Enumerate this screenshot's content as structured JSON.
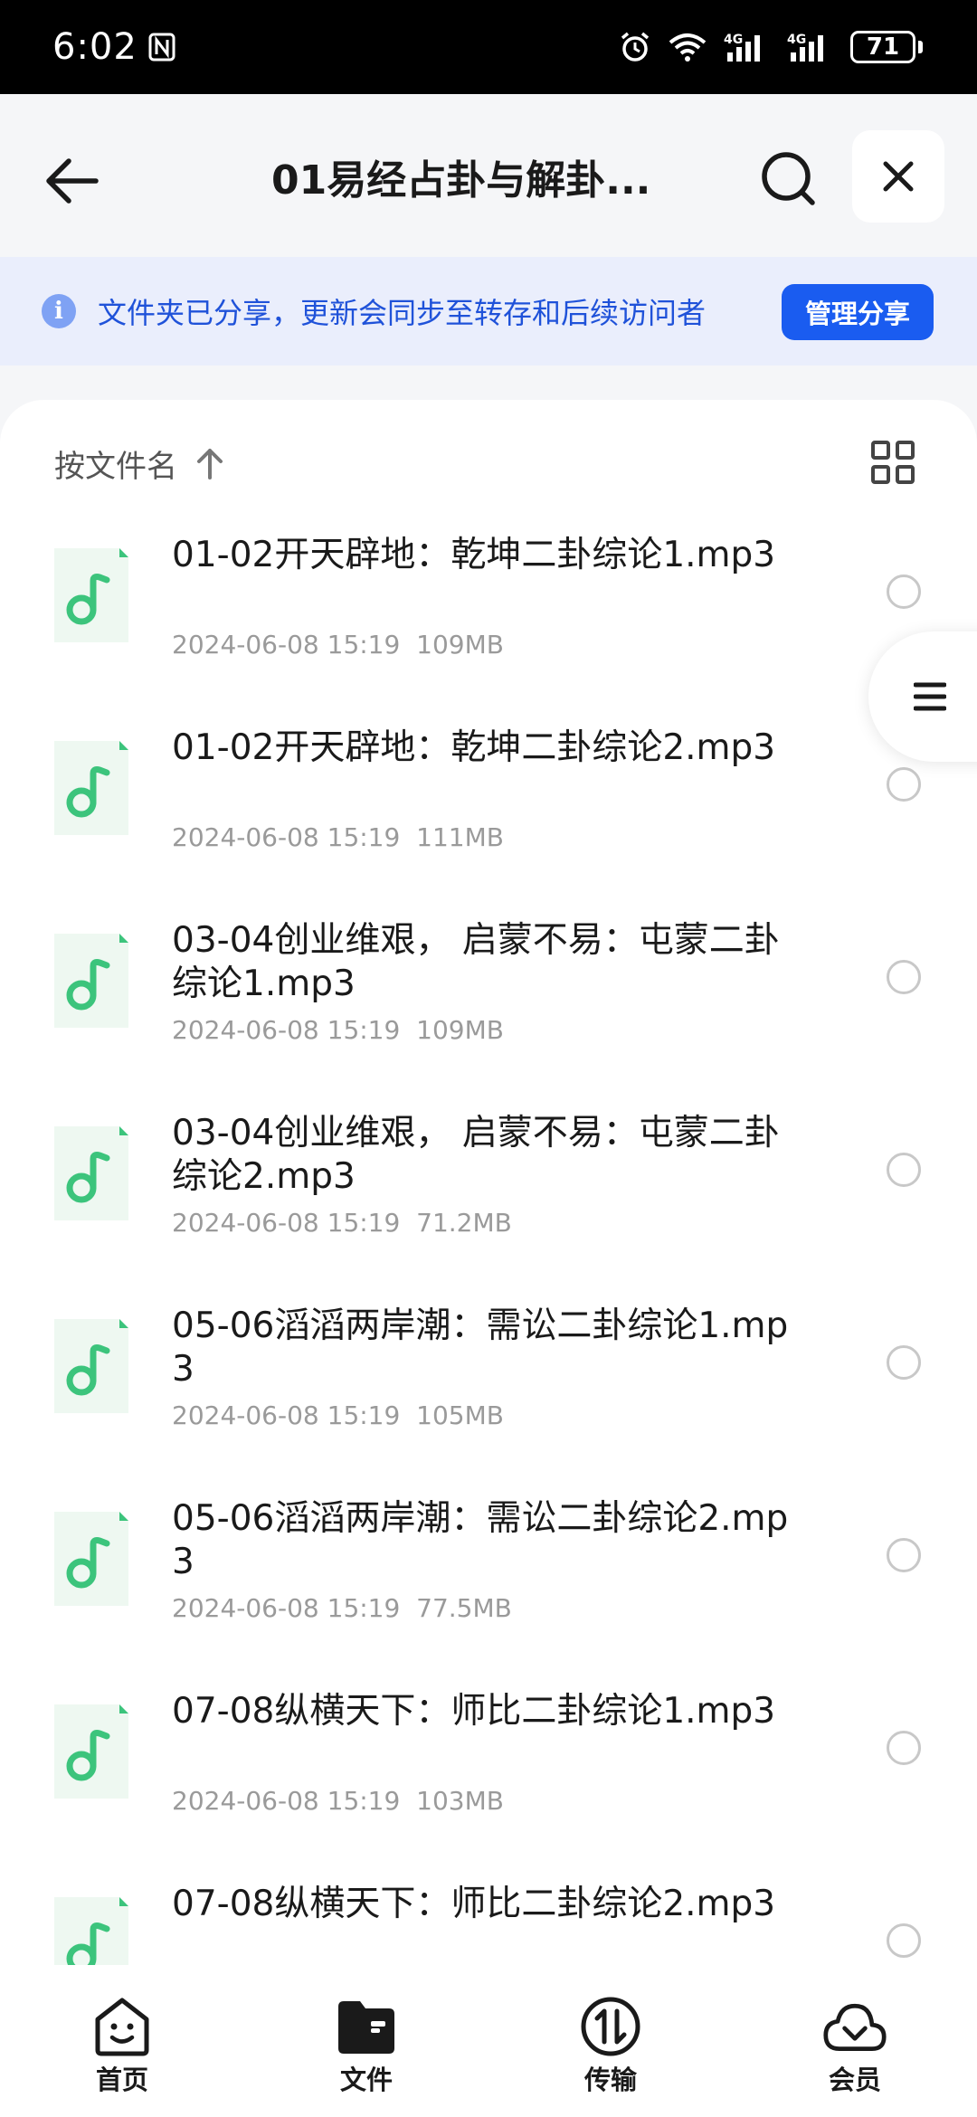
{
  "status_bar": {
    "time": "6:02",
    "battery": "71"
  },
  "header": {
    "title": "01易经占卦与解卦..."
  },
  "share_banner": {
    "text": "文件夹已分享，更新会同步至转存和后续访问者",
    "manage_label": "管理分享"
  },
  "sort": {
    "label": "按文件名"
  },
  "files": [
    {
      "name": "01-02开天辟地：乾坤二卦综论1.mp3",
      "date": "2024-06-08 15:19",
      "size": "109MB"
    },
    {
      "name": "01-02开天辟地：乾坤二卦综论2.mp3",
      "date": "2024-06-08 15:19",
      "size": "111MB"
    },
    {
      "name": "03-04创业维艰， 启蒙不易：屯蒙二卦综论1.mp3",
      "date": "2024-06-08 15:19",
      "size": "109MB"
    },
    {
      "name": "03-04创业维艰， 启蒙不易：屯蒙二卦综论2.mp3",
      "date": "2024-06-08 15:19",
      "size": "71.2MB"
    },
    {
      "name": "05-06滔滔两岸潮：需讼二卦综论1.mp3",
      "date": "2024-06-08 15:19",
      "size": "105MB"
    },
    {
      "name": "05-06滔滔两岸潮：需讼二卦综论2.mp3",
      "date": "2024-06-08 15:19",
      "size": "77.5MB"
    },
    {
      "name": "07-08纵横天下：师比二卦综论1.mp3",
      "date": "2024-06-08 15:19",
      "size": "103MB"
    },
    {
      "name": "07-08纵横天下：师比二卦综论2.mp3",
      "date": "",
      "size": ""
    }
  ],
  "nav": [
    {
      "label": "首页",
      "icon": "home-face-icon"
    },
    {
      "label": "文件",
      "icon": "folder-icon"
    },
    {
      "label": "传输",
      "icon": "transfer-icon"
    },
    {
      "label": "会员",
      "icon": "cloud-vip-icon"
    }
  ],
  "colors": {
    "accent": "#1a5cf0",
    "banner_bg": "#eaeefc",
    "music_green": "#3cc47c"
  }
}
